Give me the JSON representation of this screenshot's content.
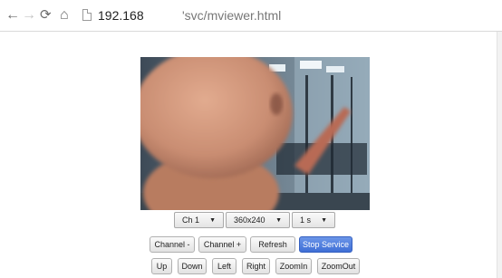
{
  "browser": {
    "url_host": "192.168",
    "url_path": "'svc/mviewer.html"
  },
  "viewer": {
    "channel_select": "Ch 1",
    "resolution_select": "360x240",
    "interval_select": "1 s",
    "buttons": {
      "channel_minus": "Channel -",
      "channel_plus": "Channel +",
      "refresh": "Refresh",
      "stop_service": "Stop Service",
      "up": "Up",
      "down": "Down",
      "left": "Left",
      "right": "Right",
      "zoom_in": "ZoomIn",
      "zoom_out": "ZoomOut"
    }
  },
  "colors": {
    "primary_button": "#4a7bdc"
  }
}
